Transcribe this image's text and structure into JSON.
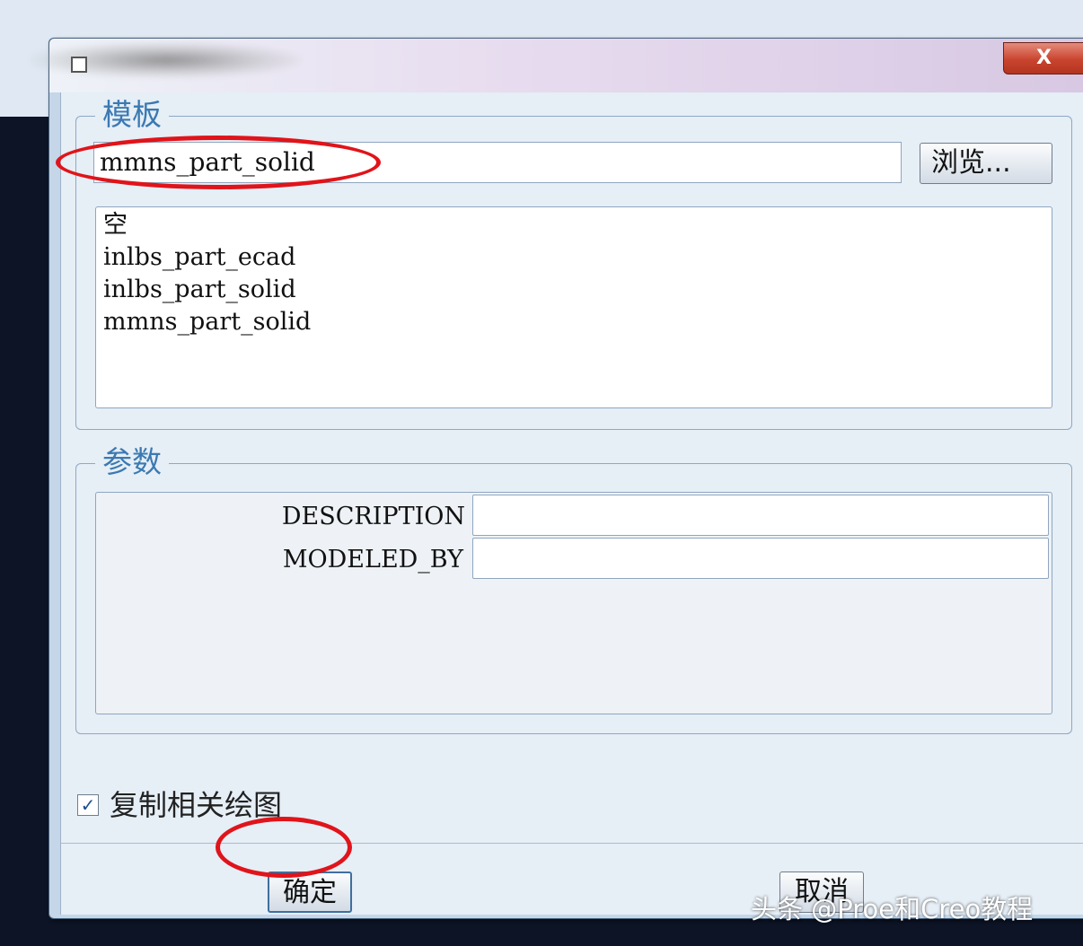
{
  "window": {
    "close_label": "X"
  },
  "template_group": {
    "label": "模板",
    "input_value": "mmns_part_solid",
    "browse_label": "浏览...",
    "items": [
      {
        "label": "空"
      },
      {
        "label": "inlbs_part_ecad"
      },
      {
        "label": "inlbs_part_solid"
      },
      {
        "label": "mmns_part_solid"
      }
    ]
  },
  "params_group": {
    "label": "参数",
    "rows": [
      {
        "name": "DESCRIPTION",
        "value": ""
      },
      {
        "name": "MODELED_BY",
        "value": ""
      }
    ]
  },
  "copy_drawings": {
    "label": "复制相关绘图",
    "checked": true,
    "mark": "✓"
  },
  "footer": {
    "ok_label": "确定",
    "cancel_label": "取消"
  },
  "watermark": "头条 @Proe和Creo教程",
  "colors": {
    "highlight_ring": "#e0141a",
    "group_label": "#3a79b2",
    "close_button": "#c9442e"
  }
}
